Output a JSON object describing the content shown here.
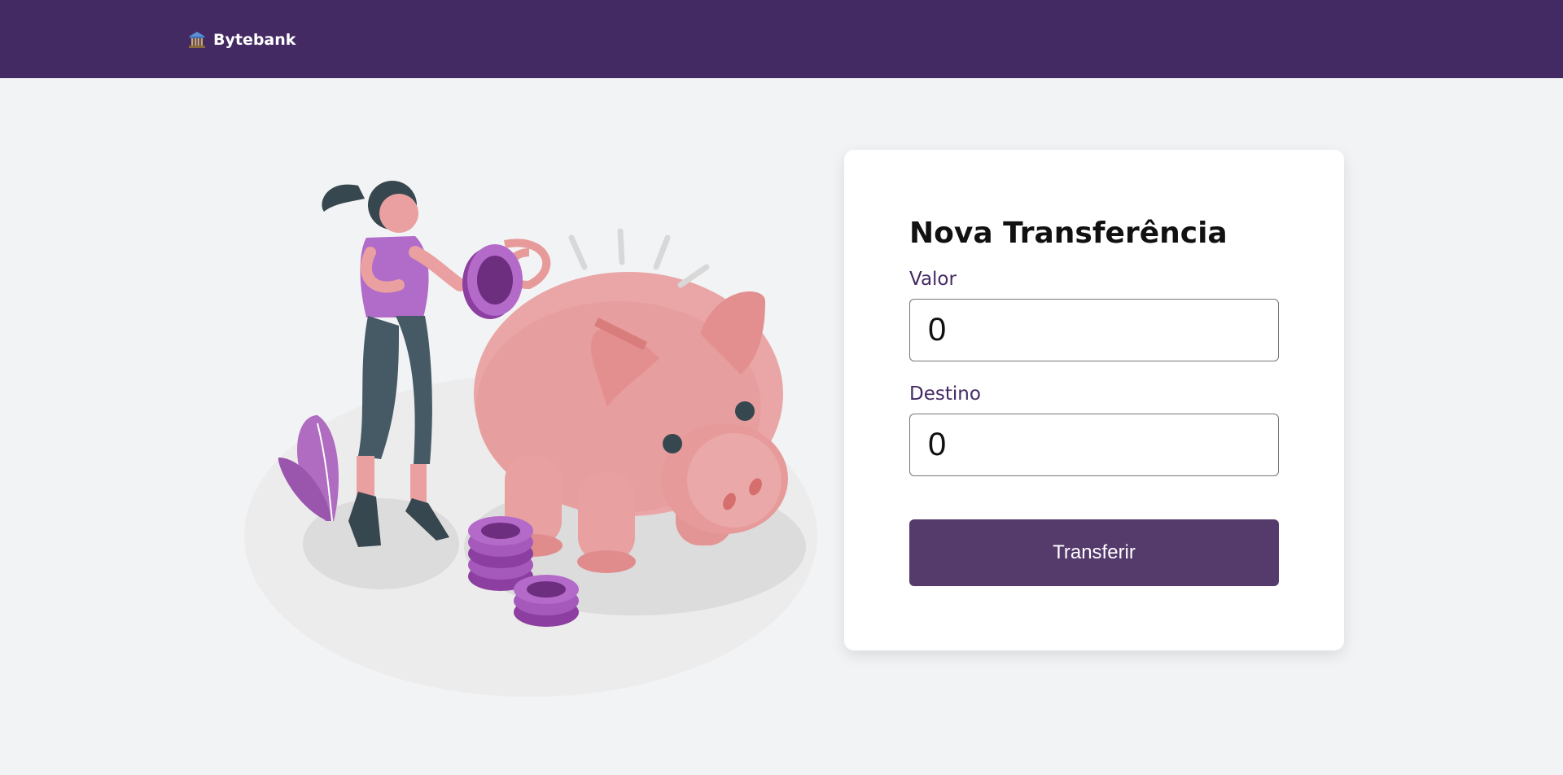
{
  "navbar": {
    "brand_name": "Bytebank",
    "brand_icon": "bank-building-icon",
    "background_color": "#442a63"
  },
  "illustration": {
    "name": "piggy-bank-illustration"
  },
  "transfer_form": {
    "title": "Nova Transferência",
    "valor_label": "Valor",
    "valor_value": "0",
    "destino_label": "Destino",
    "destino_value": "0",
    "submit_label": "Transferir",
    "submit_color": "#553a6c"
  }
}
